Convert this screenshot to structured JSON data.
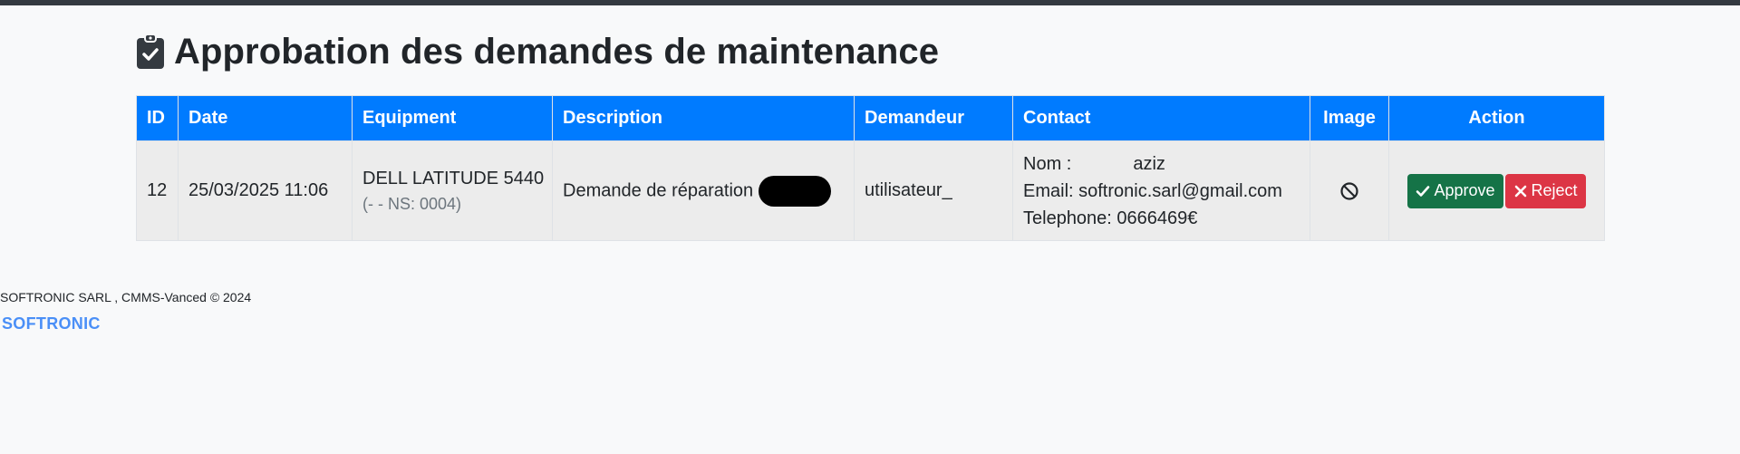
{
  "page": {
    "title": "Approbation des demandes de maintenance",
    "title_icon": "clipboard-check-icon"
  },
  "table": {
    "headers": {
      "id": "ID",
      "date": "Date",
      "equipment": "Equipment",
      "description": "Description",
      "demandeur": "Demandeur",
      "contact": "Contact",
      "image": "Image",
      "action": "Action"
    },
    "rows": [
      {
        "id": "12",
        "date": "25/03/2025 11:06",
        "equipment": "DELL LATITUDE 5440",
        "equipment_note": "(- - NS: 0004)",
        "description": "Demande de réparation",
        "demandeur": "utilisateur_",
        "contact_nom_label": "Nom :",
        "contact_nom_value": "aziz",
        "contact_email": "Email: softronic.sarl@gmail.com",
        "contact_phone": "Telephone: 0666469€",
        "image_icon": "ban-icon",
        "approve_label": "Approve",
        "reject_label": "Reject"
      }
    ]
  },
  "footer": {
    "copyright": "SOFTRONIC SARL , CMMS-Vanced © 2024",
    "brand": "SOFTRONIC"
  },
  "colors": {
    "header_bg": "#007bff",
    "approve": "#157347",
    "reject": "#dc3545",
    "brand": "#4a8ff7"
  }
}
